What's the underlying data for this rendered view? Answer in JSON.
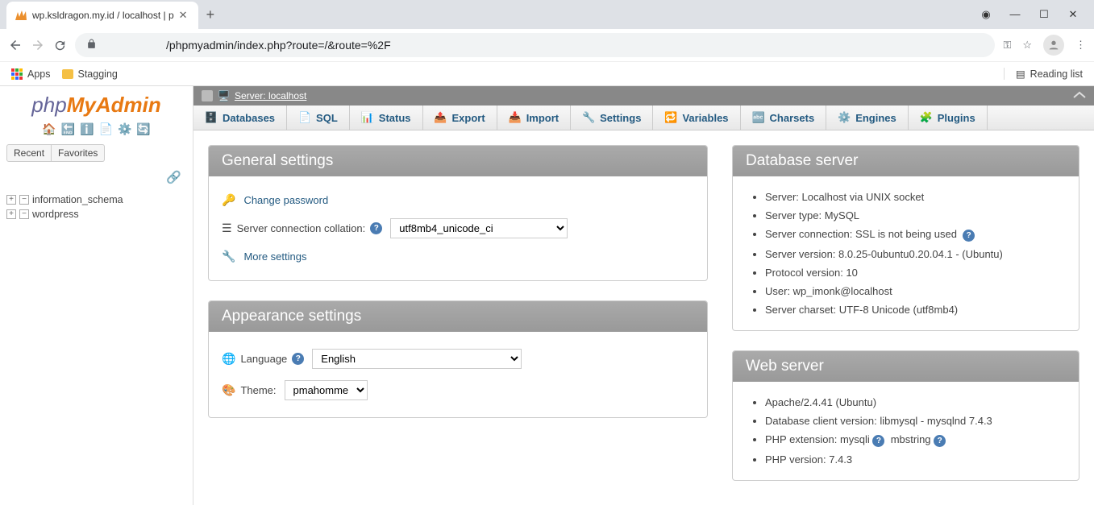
{
  "browser": {
    "tab_title": "wp.ksldragon.my.id / localhost | p",
    "url_path": "/phpmyadmin/index.php?route=/&route=%2F",
    "apps_label": "Apps",
    "bookmark1": "Stagging",
    "reading_list": "Reading list"
  },
  "sidebar": {
    "logo": {
      "php": "php",
      "my": "My",
      "admin": "Admin"
    },
    "tabs": {
      "recent": "Recent",
      "favorites": "Favorites"
    },
    "dbs": [
      "information_schema",
      "wordpress"
    ]
  },
  "breadcrumb": {
    "text": "Server: localhost"
  },
  "top_tabs": [
    "Databases",
    "SQL",
    "Status",
    "Export",
    "Import",
    "Settings",
    "Variables",
    "Charsets",
    "Engines",
    "Plugins"
  ],
  "general": {
    "title": "General settings",
    "change_password": "Change password",
    "collation_label": "Server connection collation:",
    "collation_value": "utf8mb4_unicode_ci",
    "more": "More settings"
  },
  "appearance": {
    "title": "Appearance settings",
    "language_label": "Language",
    "language_value": "English",
    "theme_label": "Theme:",
    "theme_value": "pmahomme"
  },
  "dbserver": {
    "title": "Database server",
    "items": [
      "Server: Localhost via UNIX socket",
      "Server type: MySQL",
      "Server connection: SSL is not being used",
      "Server version: 8.0.25-0ubuntu0.20.04.1 - (Ubuntu)",
      "Protocol version: 10",
      "User: wp_imonk@localhost",
      "Server charset: UTF-8 Unicode (utf8mb4)"
    ]
  },
  "webserver": {
    "title": "Web server",
    "items": [
      "Apache/2.4.41 (Ubuntu)",
      "Database client version: libmysql - mysqlnd 7.4.3",
      "PHP extension: mysqli",
      "mbstring",
      "PHP version: 7.4.3"
    ]
  }
}
